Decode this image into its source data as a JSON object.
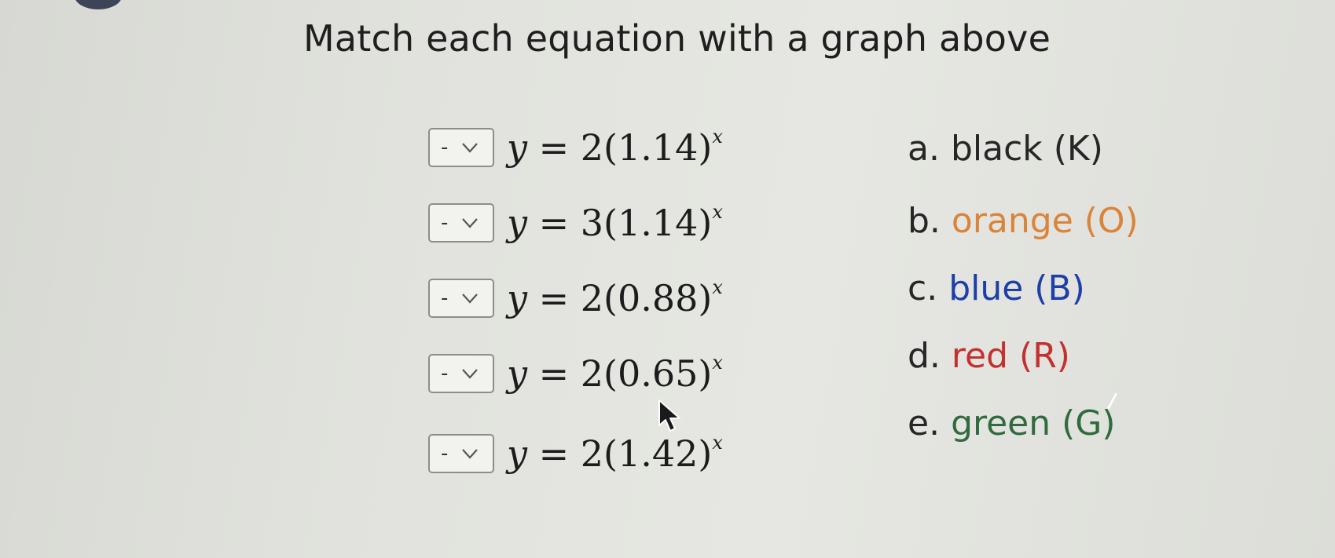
{
  "title": "Match each equation with a graph above",
  "equations": [
    {
      "select_value": "-",
      "lhs": "y",
      "rhs_text": "= 2(1.14)",
      "exponent": "x"
    },
    {
      "select_value": "-",
      "lhs": "y",
      "rhs_text": "= 3(1.14)",
      "exponent": "x"
    },
    {
      "select_value": "-",
      "lhs": "y",
      "rhs_text": "= 2(0.88)",
      "exponent": "x"
    },
    {
      "select_value": "-",
      "lhs": "y",
      "rhs_text": "= 2(0.65)",
      "exponent": "x"
    },
    {
      "select_value": "-",
      "lhs": "y",
      "rhs_text": "= 2(1.42)",
      "exponent": "x"
    }
  ],
  "options": [
    {
      "letter": "a.",
      "label": "black (K)",
      "color": "#262626"
    },
    {
      "letter": "b.",
      "label": "orange (O)",
      "color": "#d9843a"
    },
    {
      "letter": "c.",
      "label": "blue (B)",
      "color": "#1c3fa8"
    },
    {
      "letter": "d.",
      "label": "red (R)",
      "color": "#c43030"
    },
    {
      "letter": "e.",
      "label": "green (G)",
      "color": "#2f6b3e"
    }
  ],
  "icons": {
    "select_chevron": "chevron-down-icon",
    "pointer": "mouse-pointer-icon"
  }
}
